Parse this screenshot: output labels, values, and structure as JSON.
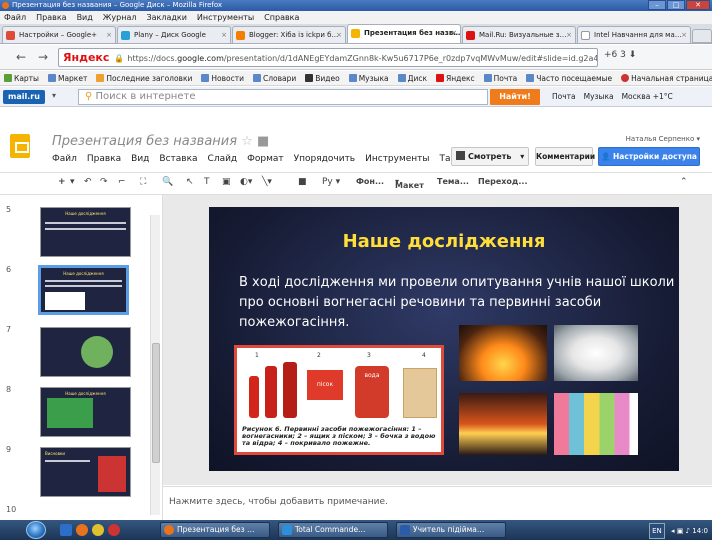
{
  "browser": {
    "window_title": "Презентация без названия – Google Диск – Mozilla Firefox",
    "menu": [
      "Файл",
      "Правка",
      "Вид",
      "Журнал",
      "Закладки",
      "Инструменты",
      "Справка"
    ],
    "tabs": [
      {
        "label": "Настройки – Google+",
        "color": "#dd4b39"
      },
      {
        "label": "Plany – Диск Google",
        "color": "#2aa0d8"
      },
      {
        "label": "Blogger: Хіба із ісkри б…",
        "color": "#f57d00"
      },
      {
        "label": "Презентация без назв…",
        "color": "#f4b400",
        "active": true
      },
      {
        "label": "Mail.Ru: Визуальные з…",
        "color": "#d11"
      },
      {
        "label": "Intel Навчання для ма…",
        "color": "#ffffff"
      }
    ],
    "yandex_label": "Яндекс",
    "url_prefix": "https://docs.",
    "url_domain": "google.com",
    "url_suffix": "/presentation/d/1dANEgEYdamZGnn8k-Kw5u6717P6e_r0zdp7vqMWvMuw/edit#slide=id.g2a4e97786_036",
    "nav_right": "+6   3",
    "bookmarks": [
      "Карты",
      "Маркет",
      "Последние заголовки",
      "Новости",
      "Словари",
      "Видео",
      "Музыка",
      "Диск",
      "Яндекс",
      "Почта",
      "Часто посещаемые",
      "Начальная страница"
    ]
  },
  "mailbar": {
    "logo": "mail.ru",
    "search_placeholder": "Поиск в интернете",
    "find_button": "Найти!",
    "right_items": [
      "Почта",
      "Музыка",
      "Москва +1°С"
    ]
  },
  "slides_app": {
    "doc_title": "Презентация без названия",
    "menu": [
      "Файл",
      "Правка",
      "Вид",
      "Вставка",
      "Слайд",
      "Формат",
      "Упорядочить",
      "Инструменты",
      "Таблица"
    ],
    "username": "Наталья Серпенко",
    "present_button": "Смотреть",
    "comments_button": "Комментарии",
    "share_button": "Настройки доступа",
    "toolbar_items": {
      "font": "Фон...",
      "layout": "Макет",
      "theme": "Тема...",
      "transition": "Переход..."
    }
  },
  "slide_panel": {
    "thumbnails": [
      {
        "num": "5",
        "title": "Наше дослідження"
      },
      {
        "num": "6",
        "title": "Наше дослідження",
        "selected": true
      },
      {
        "num": "7",
        "title": ""
      },
      {
        "num": "8",
        "title": "Наше дослідження"
      },
      {
        "num": "9",
        "title": "Висновки"
      },
      {
        "num": "10",
        "title": ""
      }
    ]
  },
  "slide": {
    "title": "Наше дослідження",
    "body": "В ході дослідження ми провели опитування учнів нашої школи про основні вогнегасні речовини та первинні засоби пожежогасіння.",
    "figure_labels": [
      "1",
      "2",
      "3",
      "4"
    ],
    "figure_sand": "пісок",
    "figure_water": "вода",
    "figure_caption": "Рисунок 6. Первинні засоби пожежогасіння: 1 – вогнегасники; 2 – ящик з піском; 3 – бочка з водою та відра; 4 – покривало пожежне."
  },
  "notes": {
    "placeholder": "Нажмите здесь, чтобы добавить примечание."
  },
  "taskbar": {
    "buttons": [
      "Презентация без …",
      "Total Commande…",
      "Учитель підійма…"
    ],
    "lang": "EN",
    "time": "14:0"
  }
}
